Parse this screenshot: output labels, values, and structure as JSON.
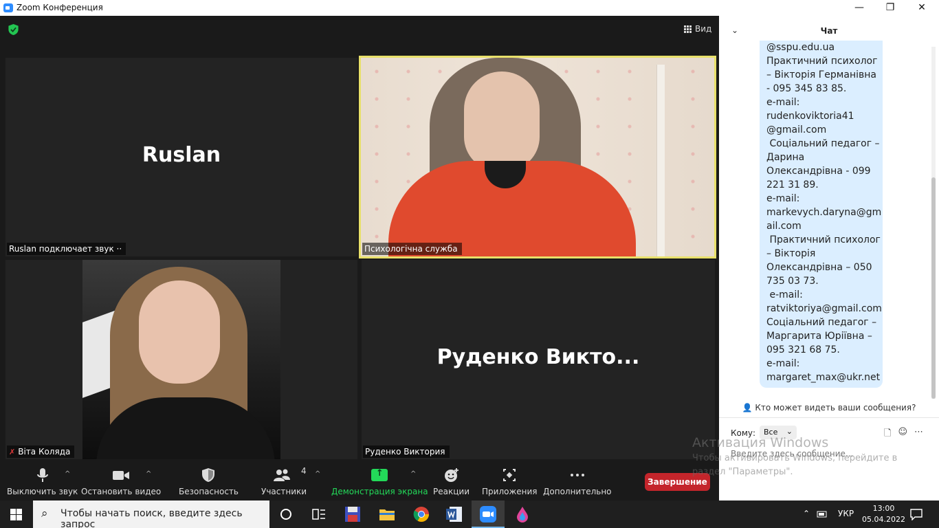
{
  "window": {
    "title": "Zoom Конференция",
    "minimize": "—",
    "restore": "❐",
    "close": "✕"
  },
  "meeting": {
    "view_label": "Вид",
    "tiles": [
      {
        "big_name": "Ruslan",
        "name_tag": "Ruslan подключает звук ··"
      },
      {
        "name_tag": "Психологічна служба"
      },
      {
        "name_tag": "Віта Коляда"
      },
      {
        "big_name": "Руденко   Викто...",
        "name_tag": "Руденко  Виктория"
      }
    ]
  },
  "toolbar": {
    "mute": "Выключить звук",
    "video": "Остановить видео",
    "security": "Безопасность",
    "participants": "Участники",
    "participants_count": "4",
    "share": "Демонстрация экрана",
    "reactions": "Реакции",
    "apps": "Приложения",
    "more": "Дополнительно",
    "end": "Завершение"
  },
  "chat": {
    "title": "Чат",
    "message_lines": [
      "@sspu.edu.ua",
      "Практичний психолог",
      "– Вікторія Германівна",
      "- 095 345 83 85.",
      "e-mail:",
      "rudenkoviktoria41",
      "@gmail.com",
      " Соціальний педагог –",
      "Дарина",
      "Олександрівна - 099",
      "221 31 89.",
      "e-mail:",
      "markevych.daryna@gm",
      "ail.com",
      " Практичний психолог",
      "– Вікторія",
      "Олександрівна – 050",
      "735 03 73.",
      " e-mail:",
      "ratviktoriya@gmail.com",
      "Соціальний педагог –",
      "Маргарита Юріївна –",
      "095 321 68 75.",
      "e-mail:",
      "margaret_max@ukr.net"
    ],
    "who_sees": "Кто может видеть ваши сообщения?",
    "to_label": "Кому:",
    "to_value": "Все",
    "input_placeholder": "Введите здесь сообщение..."
  },
  "watermark": {
    "title": "Активация Windows",
    "line1": "Чтобы активировать Windows, перейдите в",
    "line2": "раздел \"Параметры\"."
  },
  "taskbar": {
    "search_placeholder": "Чтобы начать поиск, введите здесь запрос",
    "language": "УКР",
    "time": "13:00",
    "date": "05.04.2022"
  },
  "colors": {
    "zoom_blue": "#2d8cff",
    "share_green": "#23d959",
    "end_red": "#c4252b",
    "active_speaker": "#e8e06a",
    "chat_bubble": "#dbeeff"
  }
}
